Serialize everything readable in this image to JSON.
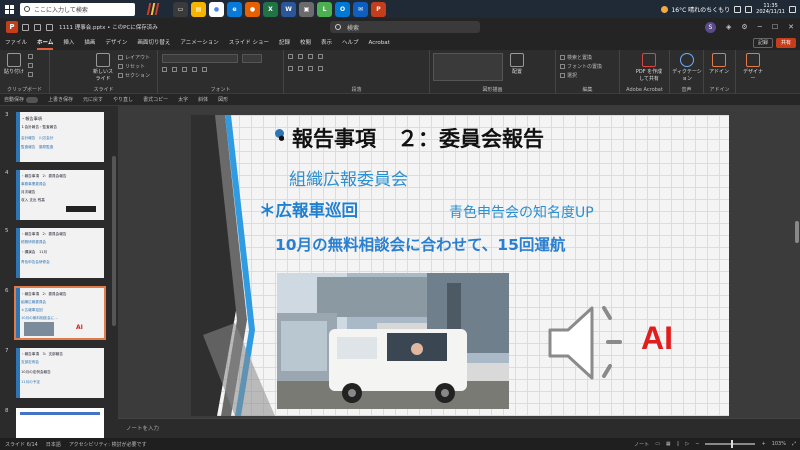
{
  "taskbar": {
    "search_placeholder": "ここに入力して検索",
    "weather": "16°C 晴れのちくもり",
    "time": "11:35",
    "date": "2024/11/11"
  },
  "titlebar": {
    "logo": "P",
    "document_title": "1111 理事会.pptx • このPCに保存済み",
    "search_placeholder": "検索",
    "avatar": "S"
  },
  "tabs": [
    {
      "label": "ファイル"
    },
    {
      "label": "ホーム"
    },
    {
      "label": "挿入"
    },
    {
      "label": "描画"
    },
    {
      "label": "デザイン"
    },
    {
      "label": "画面切り替え"
    },
    {
      "label": "アニメーション"
    },
    {
      "label": "スライド ショー"
    },
    {
      "label": "記録"
    },
    {
      "label": "校閲"
    },
    {
      "label": "表示"
    },
    {
      "label": "ヘルプ"
    },
    {
      "label": "Acrobat"
    }
  ],
  "tab_right": {
    "record": "記録",
    "share": "共有"
  },
  "ribbon": {
    "groups": [
      {
        "label": "クリップボード",
        "big": "貼り付け"
      },
      {
        "label": "スライド",
        "big": "新しいスライド",
        "items": [
          "レイアウト",
          "リセット",
          "セクション"
        ]
      },
      {
        "label": "フォント"
      },
      {
        "label": "段落"
      },
      {
        "label": "図形描画",
        "big": "配置"
      },
      {
        "label": "編集",
        "items": [
          "検索と置換",
          "フォントの置換",
          "選択"
        ]
      },
      {
        "label": "Adobe Acrobat",
        "big": "PDF を作成して共有"
      },
      {
        "label": "音声",
        "big": "ディクテーション"
      },
      {
        "label": "アドイン",
        "big": "アドイン"
      },
      {
        "label": "",
        "big": "デザイナー"
      }
    ]
  },
  "fmtbar": {
    "autosave": "自動保存",
    "save": "上書き保存",
    "items": [
      "元に戻す",
      "やり直し",
      "書式コピー",
      "太字",
      "斜体",
      "図形"
    ]
  },
  "slides": [
    {
      "num": "3",
      "lines": [
        "・報告事項",
        "１会計報告・監査報告",
        "会計報告　川辺会計",
        "監査報告　藤原監査"
      ]
    },
    {
      "num": "4",
      "lines": [
        "・報告事項　2：委員会報告",
        "事務事業委員会",
        "月次報告",
        "収入 支出 残高"
      ]
    },
    {
      "num": "5",
      "lines": [
        "・報告事項　2：委員会報告",
        "税務研修委員会",
        "・講演会　11月",
        "青色申告会研修会"
      ]
    },
    {
      "num": "6",
      "lines": [
        "・報告事項　2：委員会報告",
        "組織広報委員会",
        "＊広報車巡回",
        "10月の無料相談会に…"
      ],
      "selected": true
    },
    {
      "num": "7",
      "lines": [
        "・報告事項　3：支部報告",
        "支部定例会",
        "10月の定例会報告",
        "11月の予定"
      ]
    },
    {
      "num": "8",
      "lines": [
        ""
      ]
    }
  ],
  "slide": {
    "title": "・報告事項　２：委員会報告",
    "committee": "組織広報委員会",
    "campaign": "＊広報車巡回",
    "subtitle": "青色申告会の知名度UP",
    "detail": "10月の無料相談会に合わせて、15回運航",
    "ai_label": "AI"
  },
  "notes_placeholder": "ノートを入力",
  "status": {
    "slide_info": "スライド 6/14",
    "language": "日本語",
    "accessibility": "アクセシビリティ: 検討が必要です",
    "notes_btn": "ノート",
    "zoom": "103%"
  },
  "colors": {
    "accent": "#c43e1c",
    "slide_blue": "#2e8fcf",
    "ai_red": "#e01e1e"
  }
}
